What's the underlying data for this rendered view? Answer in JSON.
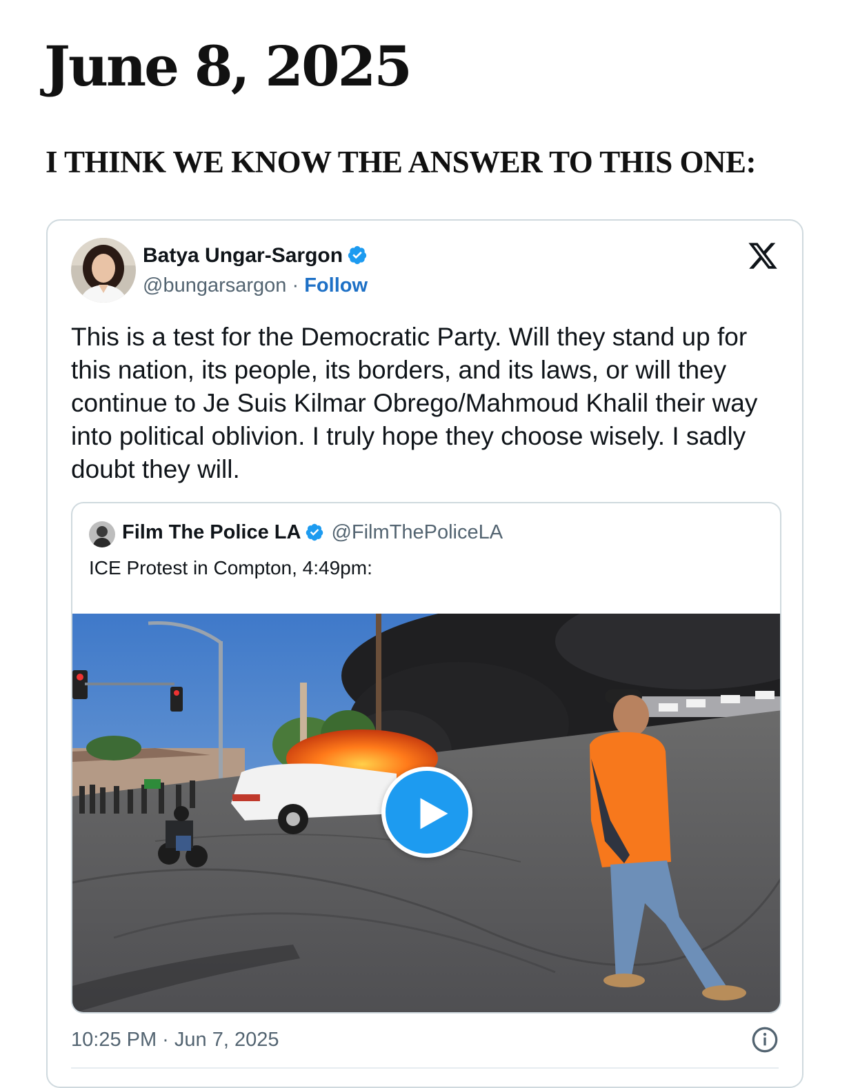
{
  "page": {
    "date": "June 8, 2025",
    "subhead": "I THINK WE KNOW THE ANSWER TO THIS ONE:"
  },
  "tweet": {
    "author_name": "Batya Ungar-Sargon",
    "handle": "@bungarsargon",
    "separator": "·",
    "follow_label": "Follow",
    "text": "This is a test for the Democratic Party. Will they stand up for this nation, its people, its borders, and its laws, or will they continue to Je Suis Kilmar Obrego/Mahmoud Khalil their way into political oblivion. I truly hope they choose wisely. I sadly doubt they will.",
    "timestamp": "10:25 PM · Jun 7, 2025",
    "icons": {
      "platform": "x-logo-icon",
      "verified": "verified-badge-icon",
      "info": "info-icon",
      "play": "play-icon"
    },
    "quoted": {
      "author_name": "Film The Police LA",
      "handle": "@FilmThePoliceLA",
      "text": "ICE Protest in Compton, 4:49pm:",
      "media_type": "video"
    }
  },
  "colors": {
    "link_blue": "#1d70c6",
    "verified_blue": "#1d9bf0",
    "secondary_text": "#536471",
    "border": "#cfd9de"
  }
}
